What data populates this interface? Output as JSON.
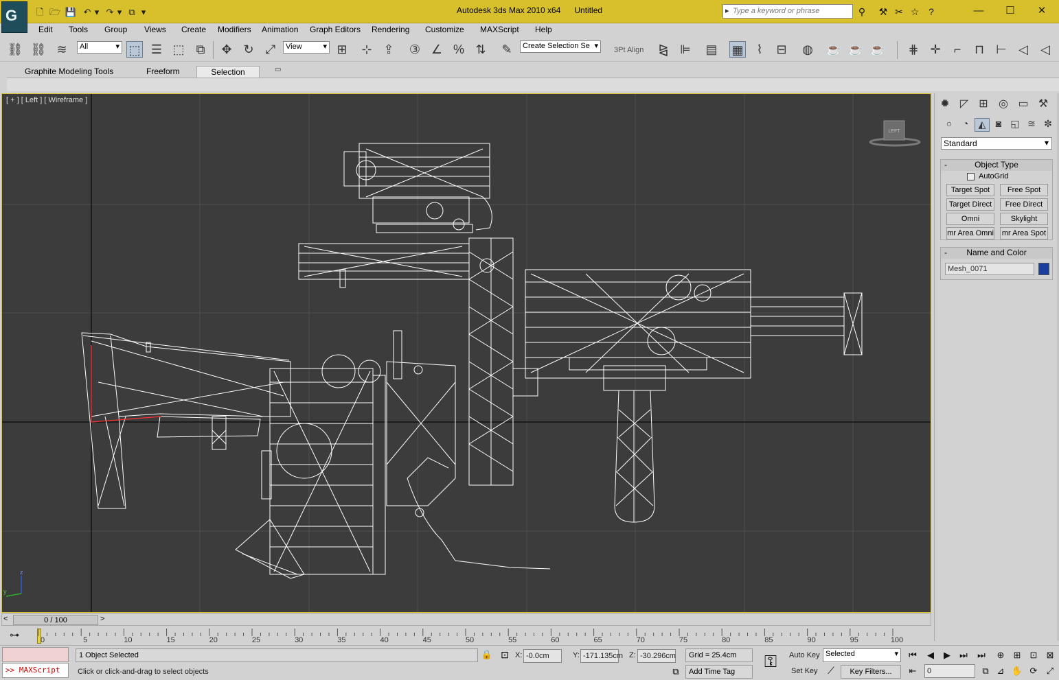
{
  "app": {
    "title": "Autodesk 3ds Max  2010 x64",
    "document": "Untitled",
    "logo_glyph": "G",
    "search_placeholder": "Type a keyword or phrase"
  },
  "menu": [
    "Edit",
    "Tools",
    "Group",
    "Views",
    "Create",
    "Modifiers",
    "Animation",
    "Graph Editors",
    "Rendering",
    "Customize",
    "MAXScript",
    "Help"
  ],
  "toolbar": {
    "filter_select": "All",
    "ref_coord_select": "View",
    "named_selection": "Create Selection Se",
    "align_label": "3Pt Align"
  },
  "ribbon": {
    "tabs": [
      "Graphite Modeling Tools",
      "Freeform",
      "Selection"
    ],
    "active_tab": "Selection"
  },
  "viewport": {
    "label": "[ + ] [ Left ] [ Wireframe ]",
    "viewcube_label": "LEFT",
    "axis_labels": {
      "z": "z",
      "y": "y"
    }
  },
  "command_panel": {
    "category": "Standard",
    "object_type": {
      "title": "Object Type",
      "autogrid": "AutoGrid",
      "buttons": [
        "Target Spot",
        "Free Spot",
        "Target Direct",
        "Free Direct",
        "Omni",
        "Skylight",
        "mr Area Omni",
        "mr Area Spot"
      ]
    },
    "name_color": {
      "title": "Name and Color",
      "name": "Mesh_0071",
      "swatch_color": "#1a3fa0"
    }
  },
  "timeline": {
    "slider": "0 / 100",
    "ticks": [
      "0",
      "5",
      "10",
      "15",
      "20",
      "25",
      "30",
      "35",
      "40",
      "45",
      "50",
      "55",
      "60",
      "65",
      "70",
      "75",
      "80",
      "85",
      "90",
      "95",
      "100"
    ]
  },
  "status": {
    "maxscript_label": ">> MAXScript",
    "selection_info": "1 Object Selected",
    "prompt": "Click or click-and-drag to select objects",
    "x_label": "X:",
    "x_value": "-0.0cm",
    "y_label": "Y:",
    "y_value": "-171.135cm",
    "z_label": "Z:",
    "z_value": "-30.296cm",
    "grid": "Grid = 25.4cm",
    "add_time_tag": "Add Time Tag",
    "auto_key": "Auto Key",
    "set_key": "Set Key",
    "key_mode_select": "Selected",
    "key_filters": "Key Filters...",
    "frame_value": "0"
  },
  "colors": {
    "title_bar": "#d8c02c",
    "viewport_bg": "#3c3c3c",
    "wire": "#ffffff"
  }
}
